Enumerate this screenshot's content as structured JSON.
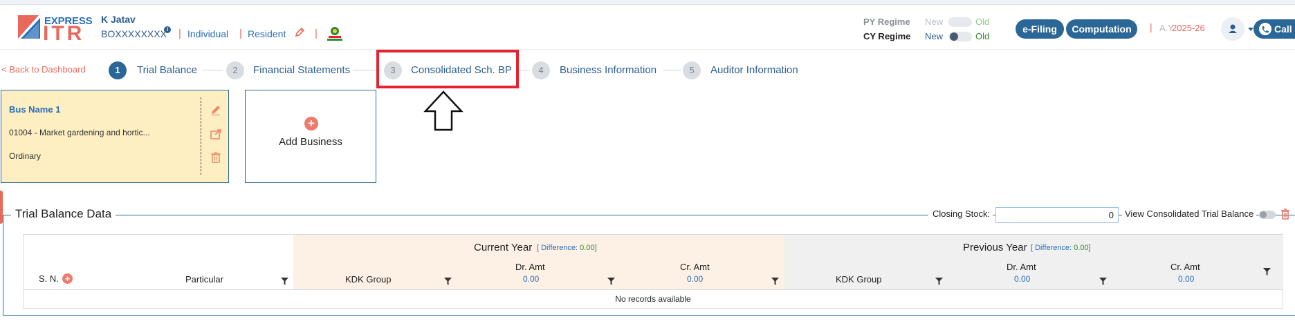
{
  "logo": {
    "express": "EXPRESS",
    "itr": "ITR"
  },
  "user": {
    "name": "K Jatav",
    "pan": "BOXXXXXXXX",
    "info_icon": "i",
    "status": "Individual",
    "residency": "Resident",
    "separator": "|"
  },
  "regime": {
    "py_label": "PY Regime",
    "cy_label": "CY Regime",
    "new": "New",
    "old": "Old"
  },
  "buttons": {
    "efiling": "e-Filing",
    "computation": "Computation",
    "call": "Call"
  },
  "assessment_year": {
    "separator": "|",
    "label": "A.Y.",
    "value": "2025-26"
  },
  "stepper": {
    "back": "< Back to Dashboard",
    "steps": [
      {
        "num": "1",
        "label": "Trial Balance"
      },
      {
        "num": "2",
        "label": "Financial Statements"
      },
      {
        "num": "3",
        "label": "Consolidated Sch. BP"
      },
      {
        "num": "4",
        "label": "Business Information"
      },
      {
        "num": "5",
        "label": "Auditor Information"
      }
    ]
  },
  "business": {
    "name": "Bus Name 1",
    "code": "01004 - Market gardening and hortic...",
    "type": "Ordinary",
    "add_plus": "+",
    "add_label": "Add Business"
  },
  "trial_balance": {
    "title": "Trial Balance Data",
    "closing_stock_label": "Closing Stock:",
    "closing_stock_value": "0",
    "view_consolidated": "View Consolidated Trial Balance",
    "sn": "S. N.",
    "sn_plus": "+",
    "particular": "Particular",
    "current_year": "Current Year",
    "previous_year": "Previous Year",
    "diff_open": "[ Difference:",
    "diff_close": "]",
    "current_diff": "0.00",
    "previous_diff": "0.00",
    "kdk_group": "KDK Group",
    "dr_amt": "Dr. Amt",
    "cr_amt": "Cr. Amt",
    "cur_dr_total": "0.00",
    "cur_cr_total": "0.00",
    "prev_dr_total": "0.00",
    "prev_cr_total": "0.00",
    "no_records": "No records available"
  },
  "colors": {
    "brand_blue": "#2b6796",
    "accent_red": "#e8695c",
    "highlight_red": "#e5222e",
    "card_yellow": "#fdefc2"
  }
}
